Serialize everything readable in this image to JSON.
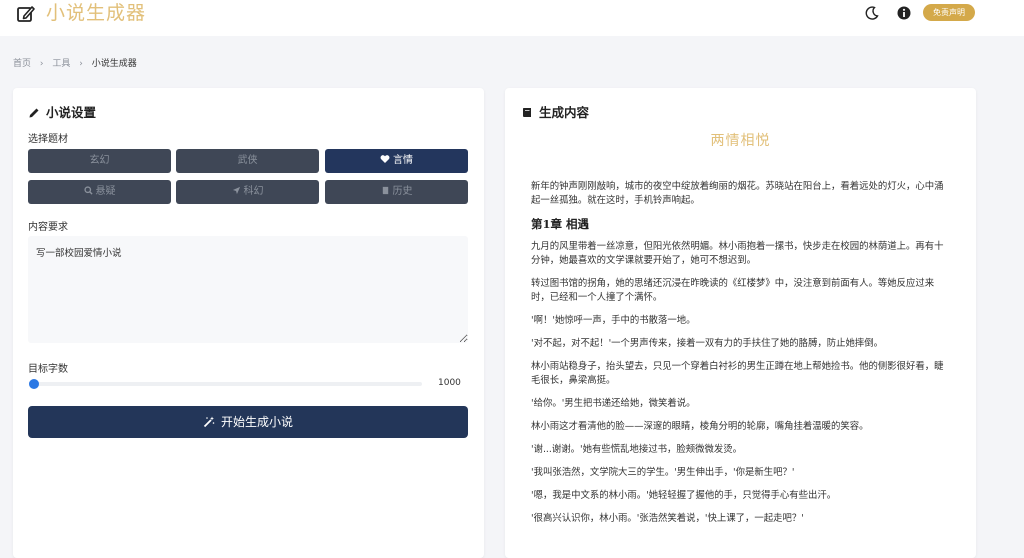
{
  "header": {
    "logo_text": "小说生成器",
    "disclaimer_label": "免责声明"
  },
  "breadcrumb": {
    "items": [
      "首页",
      "工具",
      "小说生成器"
    ]
  },
  "settings": {
    "title": "小说设置",
    "genre_label": "选择题材",
    "genres": [
      {
        "label": "玄幻",
        "icon": "",
        "active": false
      },
      {
        "label": "武侠",
        "icon": "",
        "active": false
      },
      {
        "label": "言情",
        "icon": "heart-icon",
        "active": true
      },
      {
        "label": "悬疑",
        "icon": "search-icon",
        "active": false
      },
      {
        "label": "科幻",
        "icon": "rocket-icon",
        "active": false
      },
      {
        "label": "历史",
        "icon": "book-icon",
        "active": false
      }
    ],
    "content_label": "内容要求",
    "content_value": "写一部校园爱情小说",
    "word_count_label": "目标字数",
    "word_count_value": "1000",
    "generate_label": "开始生成小说"
  },
  "output": {
    "title": "生成内容",
    "story_title": "两情相悦",
    "intro": "新年的钟声刚刚敲响，城市的夜空中绽放着绚丽的烟花。苏晓站在阳台上，看着远处的灯火，心中涌起一丝孤独。就在这时，手机铃声响起。",
    "chapter_title": "第1章 相遇",
    "paragraphs": [
      "九月的风里带着一丝凉意，但阳光依然明媚。林小雨抱着一摞书，快步走在校园的林荫道上。再有十分钟，她最喜欢的文学课就要开始了，她可不想迟到。",
      "转过图书馆的拐角，她的思绪还沉浸在昨晚读的《红楼梦》中，没注意到前面有人。等她反应过来时，已经和一个人撞了个满怀。",
      "'啊！'她惊呼一声，手中的书散落一地。",
      "'对不起，对不起！'一个男声传来，接着一双有力的手扶住了她的胳膊，防止她摔倒。",
      "林小雨站稳身子，抬头望去，只见一个穿着白衬衫的男生正蹲在地上帮她捡书。他的侧影很好看，睫毛很长，鼻梁高挺。",
      "'给你。'男生把书递还给她，微笑着说。",
      "林小雨这才看清他的脸——深邃的眼睛，棱角分明的轮廓，嘴角挂着温暖的笑容。",
      "'谢...谢谢。'她有些慌乱地接过书，脸颊微微发烫。",
      "'我叫张浩然，文学院大三的学生。'男生伸出手，'你是新生吧？'",
      "'嗯，我是中文系的林小雨。'她轻轻握了握他的手，只觉得手心有些出汗。",
      "'很高兴认识你，林小雨。'张浩然笑着说，'快上课了，一起走吧？'"
    ]
  }
}
